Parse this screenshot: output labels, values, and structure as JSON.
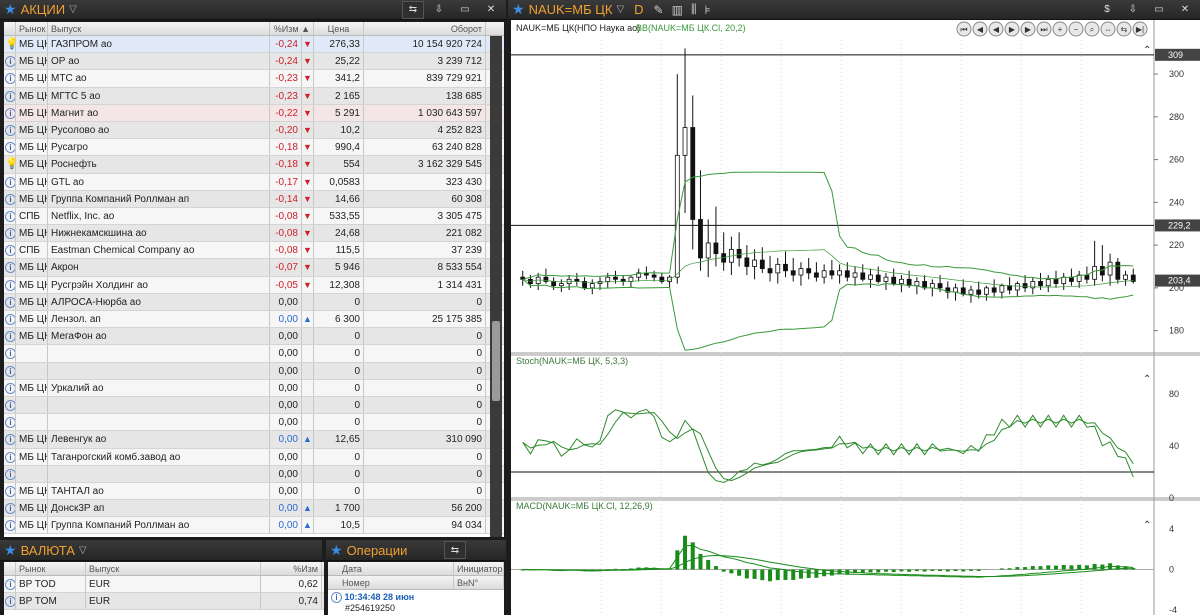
{
  "stocks": {
    "title": "АКЦИИ",
    "columns": [
      "Рынок",
      "Выпуск",
      "%Изм",
      "Цена",
      "Оборот"
    ],
    "rows": [
      {
        "icon": "bulb",
        "market": "МБ ЦК",
        "name": "ГАЗПРОМ ао",
        "chg": "-0,24",
        "dir": "down",
        "price": "276,33",
        "turnover": "10 154 920 724",
        "style": "sel"
      },
      {
        "icon": "info",
        "market": "МБ ЦК",
        "name": "ОР ао",
        "chg": "-0,24",
        "dir": "down",
        "price": "25,22",
        "turnover": "3 239 712"
      },
      {
        "icon": "info",
        "market": "МБ ЦК",
        "name": "МТС ао",
        "chg": "-0,23",
        "dir": "down",
        "price": "341,2",
        "turnover": "839 729 921"
      },
      {
        "icon": "info",
        "market": "МБ ЦК",
        "name": "МГТС 5 ао",
        "chg": "-0,23",
        "dir": "down",
        "price": "2 165",
        "turnover": "138 685"
      },
      {
        "icon": "info",
        "market": "МБ ЦК",
        "name": "Магнит ао",
        "chg": "-0,22",
        "dir": "down",
        "price": "5 291",
        "turnover": "1 030 643 597",
        "style": "pink"
      },
      {
        "icon": "info",
        "market": "МБ ЦК",
        "name": "Русолово ао",
        "chg": "-0,20",
        "dir": "down",
        "price": "10,2",
        "turnover": "4 252 823"
      },
      {
        "icon": "info",
        "market": "МБ ЦК",
        "name": "Русагро",
        "chg": "-0,18",
        "dir": "down",
        "price": "990,4",
        "turnover": "63 240 828"
      },
      {
        "icon": "bulb",
        "market": "МБ ЦК",
        "name": "Роснефть",
        "chg": "-0,18",
        "dir": "down",
        "price": "554",
        "turnover": "3 162 329 545"
      },
      {
        "icon": "info",
        "market": "МБ ЦК",
        "name": "GTL ао",
        "chg": "-0,17",
        "dir": "down",
        "price": "0,0583",
        "turnover": "323 430"
      },
      {
        "icon": "info",
        "market": "МБ ЦК",
        "name": "Группа Компаний Роллман ап",
        "chg": "-0,14",
        "dir": "down",
        "price": "14,66",
        "turnover": "60 308"
      },
      {
        "icon": "info",
        "market": "СПБ",
        "name": "Netflix, Inc. ао",
        "chg": "-0,08",
        "dir": "down",
        "price": "533,55",
        "turnover": "3 305 475"
      },
      {
        "icon": "info",
        "market": "МБ ЦК",
        "name": "Нижнекамскшина ао",
        "chg": "-0,08",
        "dir": "down",
        "price": "24,68",
        "turnover": "221 082"
      },
      {
        "icon": "info",
        "market": "СПБ",
        "name": "Eastman Chemical Company ао",
        "chg": "-0,08",
        "dir": "down",
        "price": "115,5",
        "turnover": "37 239"
      },
      {
        "icon": "info",
        "market": "МБ ЦК",
        "name": "Акрон",
        "chg": "-0,07",
        "dir": "down",
        "price": "5 946",
        "turnover": "8 533 554"
      },
      {
        "icon": "info",
        "market": "МБ ЦК",
        "name": "Русгрэйн Холдинг ао",
        "chg": "-0,05",
        "dir": "down",
        "price": "12,308",
        "turnover": "1 314 431"
      },
      {
        "icon": "info",
        "market": "МБ ЦК",
        "name": "АЛРОСА-Нюрба ао",
        "chg": "0,00",
        "dir": "",
        "price": "0",
        "turnover": "0"
      },
      {
        "icon": "info",
        "market": "МБ ЦК",
        "name": "Лензол. ап",
        "chg": "0,00",
        "dir": "up",
        "price": "6 300",
        "turnover": "25 175 385"
      },
      {
        "icon": "info",
        "market": "МБ ЦК",
        "name": "МегаФон ао",
        "chg": "0,00",
        "dir": "",
        "price": "0",
        "turnover": "0"
      },
      {
        "icon": "info",
        "market": "",
        "name": "",
        "chg": "0,00",
        "dir": "",
        "price": "0",
        "turnover": "0"
      },
      {
        "icon": "info",
        "market": "",
        "name": "",
        "chg": "0,00",
        "dir": "",
        "price": "0",
        "turnover": "0"
      },
      {
        "icon": "info",
        "market": "МБ ЦК",
        "name": "Уркалий ао",
        "chg": "0,00",
        "dir": "",
        "price": "0",
        "turnover": "0"
      },
      {
        "icon": "info",
        "market": "",
        "name": "",
        "chg": "0,00",
        "dir": "",
        "price": "0",
        "turnover": "0"
      },
      {
        "icon": "info",
        "market": "",
        "name": "",
        "chg": "0,00",
        "dir": "",
        "price": "0",
        "turnover": "0"
      },
      {
        "icon": "info",
        "market": "МБ ЦК",
        "name": "Левенгук ао",
        "chg": "0,00",
        "dir": "up",
        "price": "12,65",
        "turnover": "310 090"
      },
      {
        "icon": "info",
        "market": "МБ ЦК",
        "name": "Таганрогский комб.завод ао",
        "chg": "0,00",
        "dir": "",
        "price": "0",
        "turnover": "0"
      },
      {
        "icon": "info",
        "market": "",
        "name": "",
        "chg": "0,00",
        "dir": "",
        "price": "0",
        "turnover": "0"
      },
      {
        "icon": "info",
        "market": "МБ ЦК",
        "name": "ТАНТАЛ ао",
        "chg": "0,00",
        "dir": "",
        "price": "0",
        "turnover": "0"
      },
      {
        "icon": "info",
        "market": "МБ ЦК",
        "name": "Донск3Р ап",
        "chg": "0,00",
        "dir": "up",
        "price": "1 700",
        "turnover": "56 200"
      },
      {
        "icon": "info",
        "market": "МБ ЦК",
        "name": "Группа Компаний Роллман ао",
        "chg": "0,00",
        "dir": "up",
        "price": "10,5",
        "turnover": "94 034"
      }
    ]
  },
  "currency": {
    "title": "ВАЛЮТА",
    "columns": [
      "Рынок",
      "Выпуск",
      "%Изм"
    ],
    "rows": [
      {
        "market": "BP TOD",
        "name": "EUR",
        "chg": "0,62"
      },
      {
        "market": "BP TOM",
        "name": "EUR",
        "chg": "0,74"
      }
    ]
  },
  "operations": {
    "title": "Операции",
    "columns": [
      "Дата",
      "Инициатор"
    ],
    "columns2": [
      "Номер",
      "ВнN°"
    ],
    "row": {
      "time": "10:34:48 28 июн",
      "number": "#254619250"
    }
  },
  "chart": {
    "title": "NAUK=МБ ЦК",
    "period": "D",
    "main_label": "NAUK=МБ ЦК(НПО Наука ао)",
    "bb_label": "BB(NAUK=МБ ЦК.Cl, 20,2)",
    "stoch_label": "Stoch(NAUK=МБ ЦК, 5,3,3)",
    "macd_label": "MACD(NAUK=МБ ЦК.Cl, 12,26,9)",
    "price_ticks": [
      "300",
      "280",
      "260",
      "240",
      "220",
      "200",
      "180"
    ],
    "stoch_ticks": [
      "80",
      "40",
      "0"
    ],
    "macd_ticks": [
      "4",
      "0",
      "-4"
    ],
    "markers": {
      "top": "309",
      "mid": "229,2",
      "last": "203,4"
    },
    "colors": {
      "bb": "#3a9a3a",
      "stoch": "#2e8b2e",
      "macd": "#1a8c1a",
      "candle": "#111111"
    }
  },
  "chart_data": {
    "type": "candlestick",
    "note": "NAUK daily candles with Bollinger bands, Stochastic and MACD subpanes",
    "candles": [
      [
        205,
        208,
        201,
        204
      ],
      [
        204,
        206,
        200,
        202
      ],
      [
        202,
        207,
        199,
        205
      ],
      [
        205,
        209,
        202,
        203
      ],
      [
        203,
        205,
        199,
        201
      ],
      [
        201,
        204,
        198,
        202
      ],
      [
        202,
        206,
        199,
        204
      ],
      [
        204,
        207,
        201,
        203
      ],
      [
        203,
        205,
        199,
        200
      ],
      [
        200,
        204,
        197,
        202
      ],
      [
        202,
        205,
        199,
        203
      ],
      [
        203,
        207,
        200,
        205
      ],
      [
        205,
        208,
        202,
        204
      ],
      [
        204,
        206,
        201,
        203
      ],
      [
        203,
        206,
        200,
        205
      ],
      [
        205,
        209,
        203,
        207
      ],
      [
        207,
        210,
        204,
        206
      ],
      [
        206,
        208,
        203,
        205
      ],
      [
        205,
        207,
        202,
        203
      ],
      [
        203,
        206,
        200,
        205
      ],
      [
        205,
        300,
        202,
        262
      ],
      [
        262,
        312,
        235,
        275
      ],
      [
        275,
        290,
        218,
        232
      ],
      [
        232,
        255,
        208,
        214
      ],
      [
        214,
        232,
        205,
        221
      ],
      [
        221,
        238,
        210,
        216
      ],
      [
        216,
        226,
        208,
        212
      ],
      [
        212,
        224,
        206,
        218
      ],
      [
        218,
        226,
        210,
        214
      ],
      [
        214,
        220,
        206,
        210
      ],
      [
        210,
        218,
        204,
        213
      ],
      [
        213,
        219,
        207,
        209
      ],
      [
        209,
        215,
        203,
        207
      ],
      [
        207,
        214,
        202,
        211
      ],
      [
        211,
        217,
        205,
        208
      ],
      [
        208,
        214,
        203,
        206
      ],
      [
        206,
        212,
        201,
        209
      ],
      [
        209,
        214,
        204,
        207
      ],
      [
        207,
        212,
        203,
        205
      ],
      [
        205,
        211,
        202,
        208
      ],
      [
        208,
        213,
        204,
        206
      ],
      [
        206,
        211,
        202,
        208
      ],
      [
        208,
        212,
        203,
        205
      ],
      [
        205,
        210,
        201,
        207
      ],
      [
        207,
        211,
        203,
        204
      ],
      [
        204,
        209,
        200,
        206
      ],
      [
        206,
        210,
        202,
        203
      ],
      [
        203,
        207,
        199,
        205
      ],
      [
        205,
        209,
        201,
        202
      ],
      [
        202,
        206,
        198,
        204
      ],
      [
        204,
        208,
        200,
        201
      ],
      [
        201,
        205,
        197,
        203
      ],
      [
        203,
        206,
        199,
        200
      ],
      [
        200,
        204,
        196,
        202
      ],
      [
        202,
        206,
        198,
        200
      ],
      [
        200,
        203,
        195,
        198
      ],
      [
        198,
        202,
        194,
        200
      ],
      [
        200,
        204,
        196,
        197
      ],
      [
        197,
        201,
        193,
        199
      ],
      [
        199,
        203,
        195,
        197
      ],
      [
        197,
        201,
        194,
        200
      ],
      [
        200,
        204,
        196,
        198
      ],
      [
        198,
        202,
        195,
        201
      ],
      [
        201,
        205,
        197,
        199
      ],
      [
        199,
        203,
        196,
        202
      ],
      [
        202,
        206,
        198,
        200
      ],
      [
        200,
        205,
        197,
        203
      ],
      [
        203,
        207,
        199,
        201
      ],
      [
        201,
        206,
        198,
        204
      ],
      [
        204,
        208,
        200,
        202
      ],
      [
        202,
        207,
        199,
        205
      ],
      [
        205,
        209,
        201,
        203
      ],
      [
        203,
        208,
        200,
        206
      ],
      [
        206,
        210,
        202,
        204
      ],
      [
        204,
        222,
        201,
        210
      ],
      [
        210,
        220,
        203,
        206
      ],
      [
        206,
        216,
        201,
        212
      ],
      [
        212,
        214,
        202,
        204
      ],
      [
        204,
        208,
        201,
        206
      ],
      [
        206,
        209,
        202,
        203
      ]
    ],
    "price_ylim": [
      170,
      315
    ],
    "stoch_ylim": [
      0,
      100
    ],
    "macd_ylim": [
      -4.5,
      5.5
    ]
  }
}
